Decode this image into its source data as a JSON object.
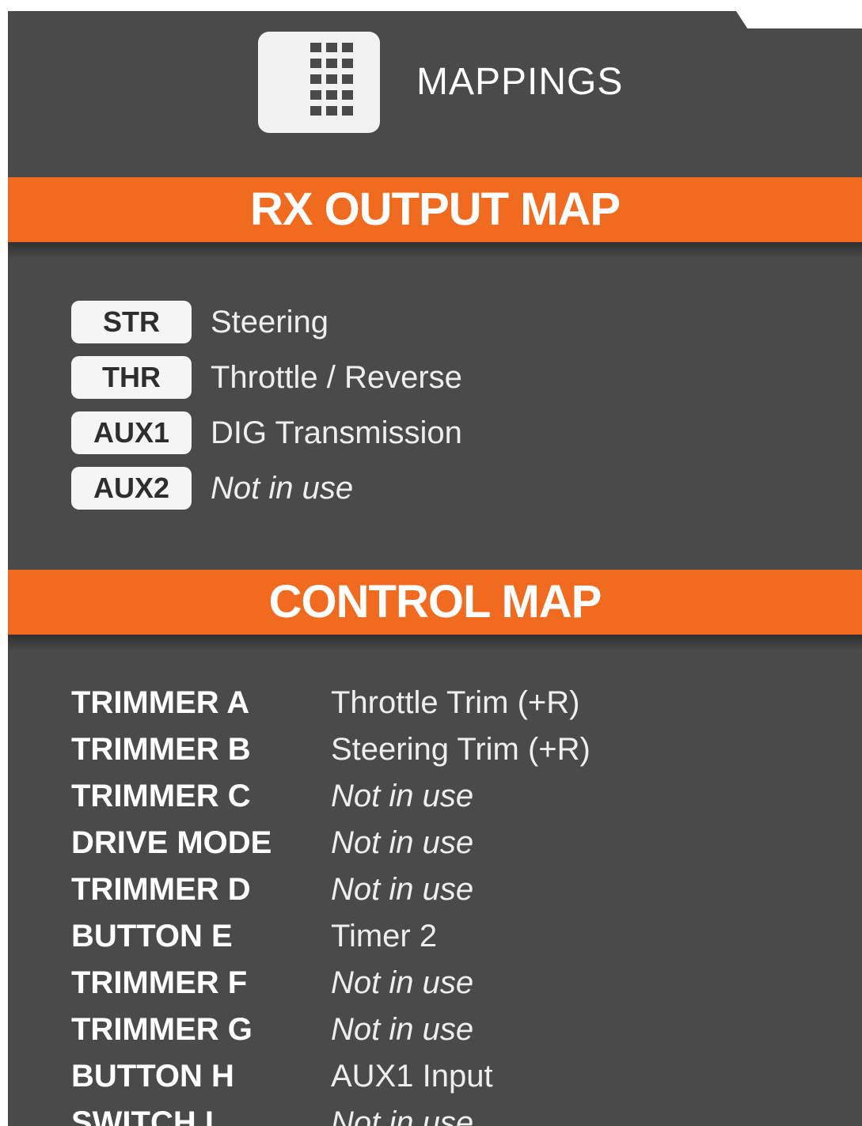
{
  "header": {
    "title": "MAPPINGS",
    "icon": "grid-icon"
  },
  "rx_output_map": {
    "title": "RX OUTPUT MAP",
    "rows": [
      {
        "badge": "STR",
        "label": "Steering",
        "italic": false
      },
      {
        "badge": "THR",
        "label": "Throttle / Reverse",
        "italic": false
      },
      {
        "badge": "AUX1",
        "label": "DIG Transmission",
        "italic": false
      },
      {
        "badge": "AUX2",
        "label": "Not in use",
        "italic": true
      }
    ]
  },
  "control_map": {
    "title": "CONTROL MAP",
    "rows": [
      {
        "control": "TRIMMER A",
        "value": "Throttle Trim (+R)",
        "italic": false
      },
      {
        "control": "TRIMMER B",
        "value": "Steering Trim (+R)",
        "italic": false
      },
      {
        "control": "TRIMMER C",
        "value": "Not in use",
        "italic": true
      },
      {
        "control": "DRIVE MODE",
        "value": "Not in use",
        "italic": true
      },
      {
        "control": "TRIMMER D",
        "value": "Not in use",
        "italic": true
      },
      {
        "control": "BUTTON E",
        "value": "Timer 2",
        "italic": false
      },
      {
        "control": "TRIMMER F",
        "value": "Not in use",
        "italic": true
      },
      {
        "control": "TRIMMER G",
        "value": "Not in use",
        "italic": true
      },
      {
        "control": "BUTTON H",
        "value": "AUX1 Input",
        "italic": false
      },
      {
        "control": "SWITCH I",
        "value": "Not in use",
        "italic": true
      }
    ]
  },
  "colors": {
    "panel": "#4a4a4a",
    "accent": "#f06b20",
    "badge": "#f5f5f5"
  }
}
